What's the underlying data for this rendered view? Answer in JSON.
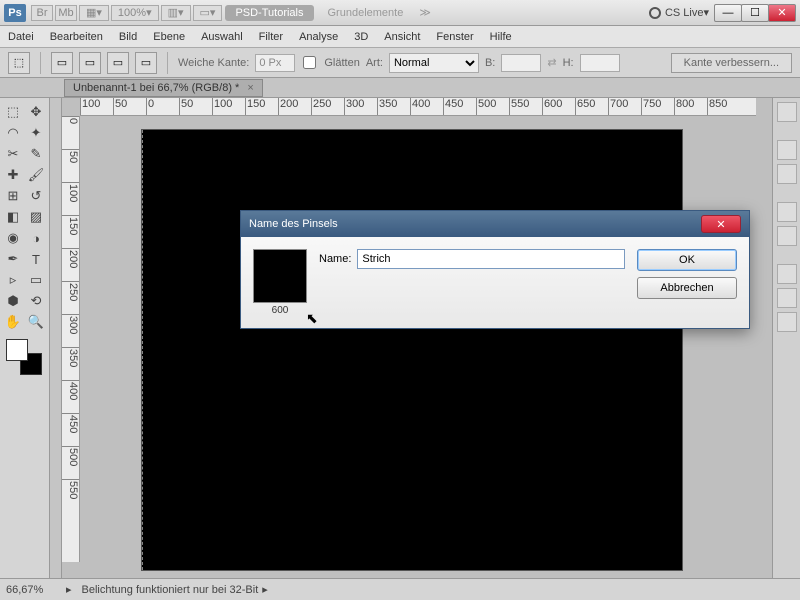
{
  "titlebar": {
    "app": "Ps",
    "zoom": "100%",
    "pill_active": "PSD-Tutorials",
    "pill_inactive": "Grundelemente",
    "cslive": "CS Live"
  },
  "menu": [
    "Datei",
    "Bearbeiten",
    "Bild",
    "Ebene",
    "Auswahl",
    "Filter",
    "Analyse",
    "3D",
    "Ansicht",
    "Fenster",
    "Hilfe"
  ],
  "optbar": {
    "weiche": "Weiche Kante:",
    "weiche_val": "0 Px",
    "glaetten": "Glätten",
    "art": "Art:",
    "art_val": "Normal",
    "b": "B:",
    "h": "H:",
    "endbtn": "Kante verbessern..."
  },
  "doctab": "Unbenannt-1 bei 66,7% (RGB/8) *",
  "ruler_h": [
    "100",
    "50",
    "0",
    "50",
    "100",
    "150",
    "200",
    "250",
    "300",
    "350",
    "400",
    "450",
    "500",
    "550",
    "600",
    "650",
    "700",
    "750",
    "800",
    "850"
  ],
  "ruler_v": [
    "0",
    "50",
    "100",
    "150",
    "200",
    "250",
    "300",
    "350",
    "400",
    "450",
    "500",
    "550"
  ],
  "status": {
    "zoom": "66,67%",
    "text": "Belichtung funktioniert nur bei 32-Bit"
  },
  "dialog": {
    "title": "Name des Pinsels",
    "preview_size": "600",
    "name_label": "Name:",
    "name_value": "Strich",
    "ok": "OK",
    "cancel": "Abbrechen"
  },
  "tools": [
    "▭",
    "▸",
    "⬚",
    "✦",
    "✂",
    "✎",
    "✐",
    "◫",
    "⌫",
    "▞",
    "◑",
    "✚",
    "⟲",
    "◔",
    "⊿",
    "T",
    "▹",
    "▭",
    "✋",
    "🔍"
  ]
}
